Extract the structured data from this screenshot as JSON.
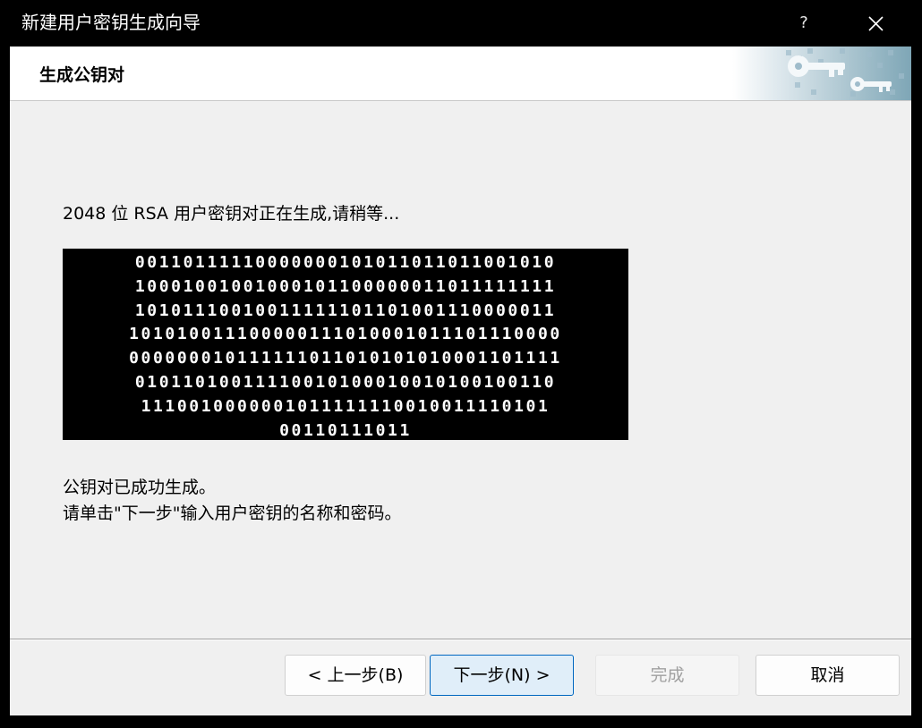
{
  "window": {
    "title": "新建用户密钥生成向导",
    "help_label": "?"
  },
  "header": {
    "title": "生成公钥对"
  },
  "main": {
    "status_text": "2048 位 RSA 用户密钥对正在生成,请稍等...",
    "binary_lines": [
      "001101111100000001010110110110010 10",
      "1000100100100010110000001101111111 1",
      "1010111001001111110110100111000001 1",
      "1010100111000001110100010111011100 00",
      "0000000101111110110101010100011011 11",
      "0101101001111001010001001010010011 0",
      "1110010000001011111110010011110101",
      "00110111011"
    ],
    "done_line1": "公钥对已成功生成。",
    "done_line2": "请单击\"下一步\"输入用户密钥的名称和密码。"
  },
  "buttons": {
    "back": "< 上一步(B)",
    "next": "下一步(N) >",
    "finish": "完成",
    "cancel": "取消"
  },
  "colors": {
    "dialog_bg": "#f0f0f0",
    "titlebar_bg": "#000000",
    "primary_border": "#0067c0",
    "primary_bg": "#e0eef9",
    "disabled_text": "#a0a0a0"
  },
  "icons": {
    "close": "close-icon",
    "header_art": "keys-banner-icon"
  }
}
